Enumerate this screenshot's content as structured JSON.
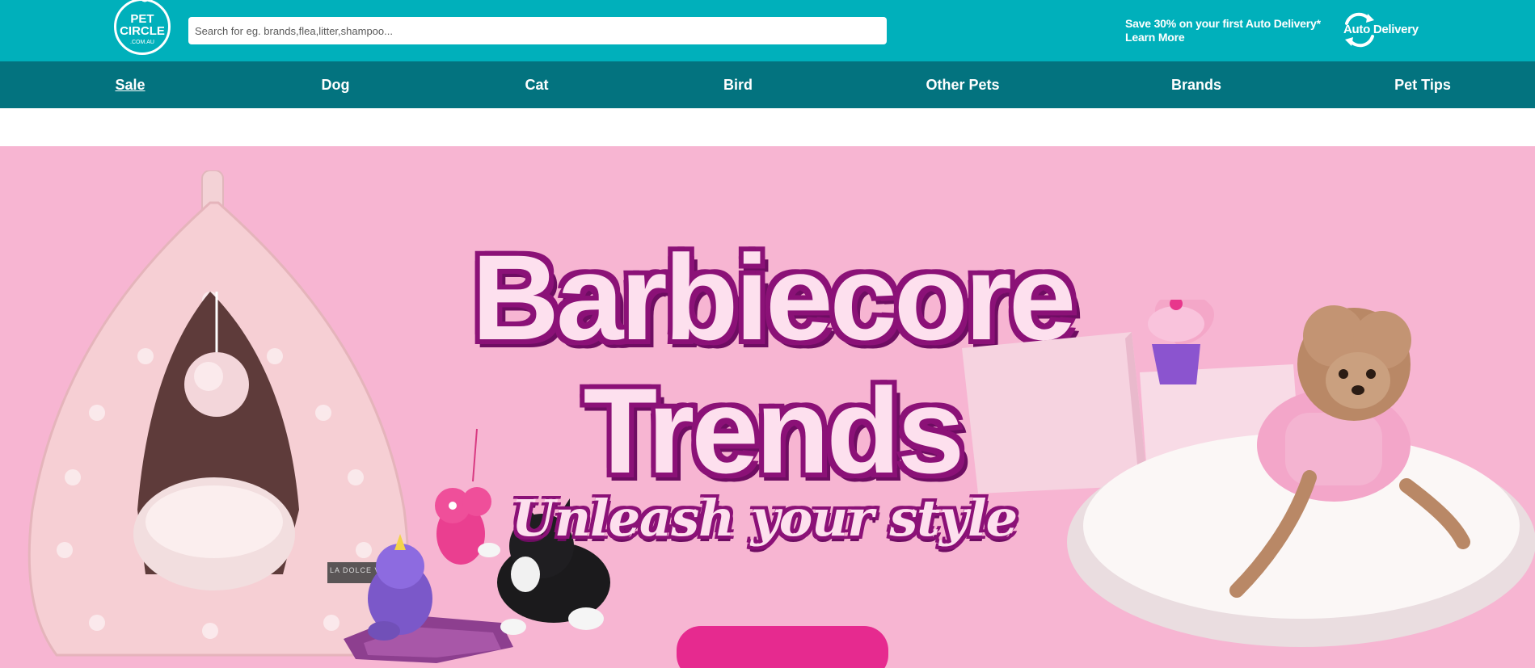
{
  "header": {
    "logo": {
      "line1": "PET",
      "line2": "CIRCLE",
      "line3": ".COM.AU"
    },
    "search": {
      "placeholder": "Search for eg. brands,flea,litter,shampoo..."
    },
    "promo": {
      "text": "Save 30% on your first Auto Delivery*",
      "link": "Learn More"
    },
    "auto_delivery_logo": {
      "text": "Auto Delivery",
      "icon": "refresh-arrows-icon"
    }
  },
  "nav": {
    "items": [
      {
        "label": "Sale",
        "active": true
      },
      {
        "label": "Dog"
      },
      {
        "label": "Cat"
      },
      {
        "label": "Bird"
      },
      {
        "label": "Other Pets"
      },
      {
        "label": "Brands"
      },
      {
        "label": "Pet Tips"
      }
    ]
  },
  "hero": {
    "title_line1": "Barbiecore",
    "title_line2": "Trends",
    "tagline": "Unleash your style",
    "tent_label": "LA DOLCE VITA",
    "colors": {
      "background": "#f7b5d2",
      "title_outline": "#8b1177",
      "cta": "#e62a8f"
    }
  },
  "colors": {
    "header_bg": "#00b0bb",
    "nav_bg": "#03737f"
  }
}
